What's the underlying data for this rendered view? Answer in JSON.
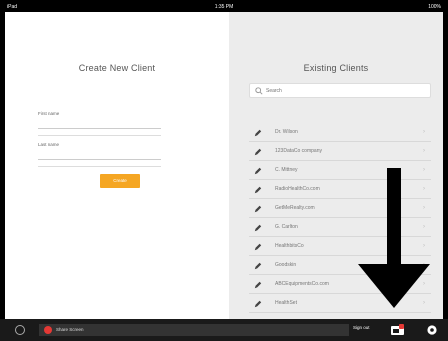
{
  "status_bar": {
    "left": "iPad",
    "center": "1:35 PM",
    "right": "100%"
  },
  "create": {
    "title": "Create New Client",
    "first_name_label": "First name",
    "last_name_label": "Last name",
    "first_name_value": "",
    "last_name_value": "",
    "button_label": "Create"
  },
  "existing": {
    "title": "Existing Clients",
    "search_placeholder": "Search",
    "clients": [
      "Dr. Wilson",
      "123DataCo company",
      "C. Mittney",
      "RadioHealthCo.com",
      "GetMeRealty.com",
      "G. Carlton",
      "HealthbitsCo",
      "Goodskin",
      "ABCEquipmentsCo.com",
      "HealthSet"
    ]
  },
  "bottom_bar": {
    "share_label": "Share Screen",
    "sign_out_label": "Sign out"
  },
  "icons": {
    "search": "search-icon",
    "pencil": "pencil-icon",
    "chevron": "chevron-right-icon",
    "share": "record-icon",
    "badge": "screen-share-icon",
    "gear": "gear-icon",
    "arrow": "down-arrow-annotation"
  },
  "colors": {
    "accent": "#f5a623",
    "record": "#e53935"
  }
}
